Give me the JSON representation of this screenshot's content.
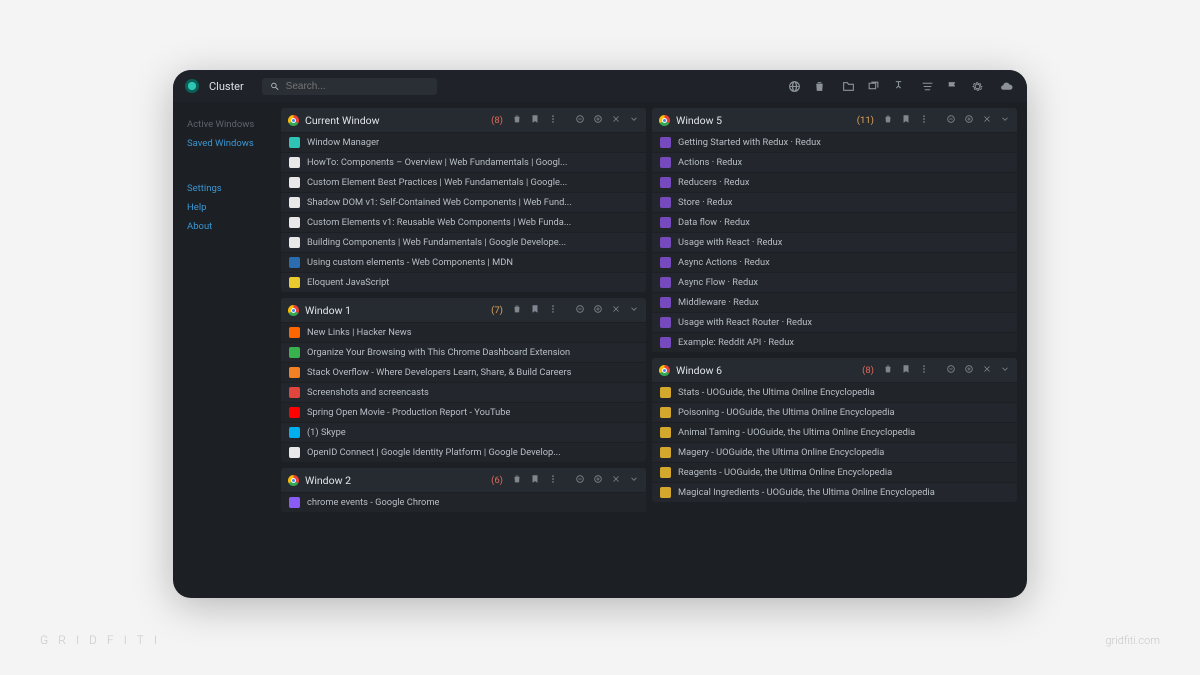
{
  "branding": {
    "name": "Cluster",
    "watermark_left": "GRIDFITI",
    "watermark_right": "gridfiti.com"
  },
  "search": {
    "placeholder": "Search..."
  },
  "sidebar": {
    "active_windows": "Active Windows",
    "saved_windows": "Saved Windows",
    "settings": "Settings",
    "help": "Help",
    "about": "About"
  },
  "columns": [
    {
      "panels": [
        {
          "title": "Current Window",
          "count": "(8)",
          "count_color": "red",
          "tabs": [
            {
              "title": "Window Manager",
              "fav": "#2ec4b6"
            },
            {
              "title": "HowTo: Components – Overview | Web Fundamentals | Googl...",
              "fav": "#e8e8e8"
            },
            {
              "title": "Custom Element Best Practices | Web Fundamentals | Google...",
              "fav": "#e8e8e8"
            },
            {
              "title": "Shadow DOM v1: Self-Contained Web Components | Web Fund...",
              "fav": "#e8e8e8"
            },
            {
              "title": "Custom Elements v1: Reusable Web Components | Web Funda...",
              "fav": "#e8e8e8"
            },
            {
              "title": "Building Components | Web Fundamentals | Google Develope...",
              "fav": "#e8e8e8"
            },
            {
              "title": "Using custom elements - Web Components | MDN",
              "fav": "#2b6cb0"
            },
            {
              "title": "Eloquent JavaScript",
              "fav": "#e8c92e"
            }
          ]
        },
        {
          "title": "Window 1",
          "count": "(7)",
          "count_color": "orange",
          "tabs": [
            {
              "title": "New Links | Hacker News",
              "fav": "#ff6600"
            },
            {
              "title": "Organize Your Browsing with This Chrome Dashboard Extension",
              "fav": "#37b24d"
            },
            {
              "title": "Stack Overflow - Where Developers Learn, Share, & Build Careers",
              "fav": "#f48024"
            },
            {
              "title": "Screenshots and screencasts",
              "fav": "#e0463c"
            },
            {
              "title": "Spring Open Movie - Production Report - YouTube",
              "fav": "#ff0000"
            },
            {
              "title": "(1) Skype",
              "fav": "#00aff0"
            },
            {
              "title": "OpenID Connect | Google Identity Platform | Google Develop...",
              "fav": "#e8e8e8"
            }
          ]
        },
        {
          "title": "Window 2",
          "count": "(6)",
          "count_color": "red",
          "tabs": [
            {
              "title": "chrome events - Google Chrome",
              "fav": "#8a5cf5"
            }
          ]
        }
      ]
    },
    {
      "panels": [
        {
          "title": "Window 5",
          "count": "(11)",
          "count_color": "orange",
          "tabs": [
            {
              "title": "Getting Started with Redux · Redux",
              "fav": "#764abc"
            },
            {
              "title": "Actions · Redux",
              "fav": "#764abc"
            },
            {
              "title": "Reducers · Redux",
              "fav": "#764abc"
            },
            {
              "title": "Store · Redux",
              "fav": "#764abc"
            },
            {
              "title": "Data flow · Redux",
              "fav": "#764abc"
            },
            {
              "title": "Usage with React · Redux",
              "fav": "#764abc"
            },
            {
              "title": "Async Actions · Redux",
              "fav": "#764abc"
            },
            {
              "title": "Async Flow · Redux",
              "fav": "#764abc"
            },
            {
              "title": "Middleware · Redux",
              "fav": "#764abc"
            },
            {
              "title": "Usage with React Router · Redux",
              "fav": "#764abc"
            },
            {
              "title": "Example: Reddit API · Redux",
              "fav": "#764abc"
            }
          ]
        },
        {
          "title": "Window 6",
          "count": "(8)",
          "count_color": "red",
          "tabs": [
            {
              "title": "Stats - UOGuide, the Ultima Online Encyclopedia",
              "fav": "#d4a82c"
            },
            {
              "title": "Poisoning - UOGuide, the Ultima Online Encyclopedia",
              "fav": "#d4a82c"
            },
            {
              "title": "Animal Taming - UOGuide, the Ultima Online Encyclopedia",
              "fav": "#d4a82c"
            },
            {
              "title": "Magery - UOGuide, the Ultima Online Encyclopedia",
              "fav": "#d4a82c"
            },
            {
              "title": "Reagents - UOGuide, the Ultima Online Encyclopedia",
              "fav": "#d4a82c"
            },
            {
              "title": "Magical Ingredients - UOGuide, the Ultima Online Encyclopedia",
              "fav": "#d4a82c"
            }
          ]
        }
      ]
    }
  ]
}
